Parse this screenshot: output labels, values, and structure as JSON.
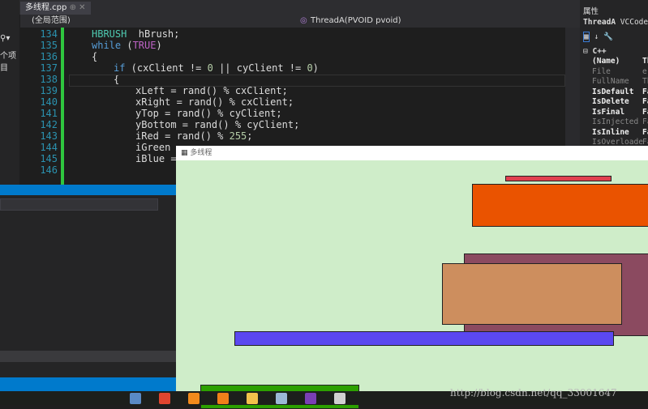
{
  "editor": {
    "tab_label": "多线程.cpp",
    "scope_dropdown": "(全局范围)",
    "function_dropdown": "ThreadA(PVOID pvoid)",
    "lines": [
      {
        "num": "134",
        "indent": 0,
        "parts": [
          [
            "ty",
            "HBRUSH"
          ],
          [
            "",
            "  hBrush;"
          ]
        ]
      },
      {
        "num": "135",
        "indent": 0,
        "parts": [
          [
            "kw",
            "while"
          ],
          [
            "",
            " ("
          ],
          [
            "mc",
            "TRUE"
          ],
          [
            "",
            ")"
          ]
        ]
      },
      {
        "num": "136",
        "indent": 0,
        "parts": [
          [
            "",
            "{"
          ]
        ]
      },
      {
        "num": "137",
        "indent": 1,
        "parts": [
          [
            "kw",
            "if"
          ],
          [
            "",
            " (cxClient != "
          ],
          [
            "nu",
            "0"
          ],
          [
            "",
            " || cyClient != "
          ],
          [
            "nu",
            "0"
          ],
          [
            "",
            ")"
          ]
        ]
      },
      {
        "num": "138",
        "indent": 1,
        "parts": [
          [
            "",
            "{"
          ]
        ]
      },
      {
        "num": "139",
        "indent": 2,
        "parts": [
          [
            "",
            "xLeft = rand() % cxClient;"
          ]
        ]
      },
      {
        "num": "140",
        "indent": 2,
        "parts": [
          [
            "",
            "xRight = rand() % cxClient;"
          ]
        ]
      },
      {
        "num": "141",
        "indent": 2,
        "parts": [
          [
            "",
            "yTop = rand() % cyClient;"
          ]
        ]
      },
      {
        "num": "142",
        "indent": 2,
        "parts": [
          [
            "",
            "yBottom = rand() % cyClient;"
          ]
        ]
      },
      {
        "num": "143",
        "indent": 2,
        "parts": [
          [
            "",
            "iRed = rand() % "
          ],
          [
            "nu",
            "255"
          ],
          [
            "",
            ";"
          ]
        ]
      },
      {
        "num": "144",
        "indent": 2,
        "parts": [
          [
            "",
            "iGreen ="
          ]
        ]
      },
      {
        "num": "145",
        "indent": 2,
        "parts": [
          [
            "",
            "iBlue ="
          ]
        ]
      },
      {
        "num": "146",
        "indent": 0,
        "parts": [
          [
            "",
            ""
          ]
        ]
      }
    ]
  },
  "left_panel": {
    "fragment": "个项目"
  },
  "properties": {
    "title": "属性",
    "object": "ThreadA",
    "object_type": "VCCodeF",
    "category": "C++",
    "rows": [
      {
        "name": "(Name)",
        "value": "Th",
        "bold": true
      },
      {
        "name": "File",
        "value": "e",
        "bold": false
      },
      {
        "name": "FullName",
        "value": "Th",
        "bold": false
      },
      {
        "name": "IsDefault",
        "value": "Fa",
        "bold": true
      },
      {
        "name": "IsDelete",
        "value": "Fa",
        "bold": true
      },
      {
        "name": "IsFinal",
        "value": "Fa",
        "bold": true
      },
      {
        "name": "IsInjected",
        "value": "Fa",
        "bold": false
      },
      {
        "name": "IsInline",
        "value": "Fa",
        "bold": true
      },
      {
        "name": "IsOverloade",
        "value": "Fa",
        "bold": false
      }
    ]
  },
  "child_window": {
    "title": "多线程",
    "background": "#cfedc9",
    "rectangles": [
      {
        "color": "#e0404f"
      },
      {
        "color": "#ea5300"
      },
      {
        "color": "#8b4a60"
      },
      {
        "color": "#cd8e5e"
      },
      {
        "color": "#5b48f0"
      },
      {
        "color": "#2ca000"
      }
    ]
  },
  "taskbar": {
    "apps": [
      "app-1",
      "chrome",
      "app-3",
      "app-4",
      "file-explorer",
      "app-6",
      "visual-studio",
      "multithread-app"
    ]
  },
  "watermark": "http://blog.csdn.net/qq_33001647"
}
